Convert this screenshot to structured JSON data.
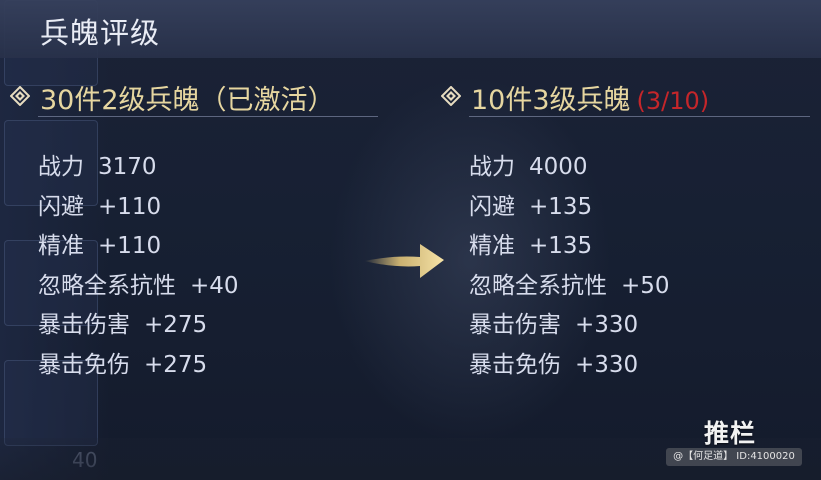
{
  "title": "兵魄评级",
  "left_panel": {
    "header": "30件2级兵魄（已激活）",
    "stats": [
      {
        "label": "战力",
        "value": "3170"
      },
      {
        "label": "闪避",
        "value": "+110"
      },
      {
        "label": "精准",
        "value": "+110"
      },
      {
        "label": "忽略全系抗性",
        "value": "+40"
      },
      {
        "label": "暴击伤害",
        "value": "+275"
      },
      {
        "label": "暴击免伤",
        "value": "+275"
      }
    ]
  },
  "right_panel": {
    "header": "10件3级兵魄",
    "progress": "(3/10)",
    "stats": [
      {
        "label": "战力",
        "value": "4000"
      },
      {
        "label": "闪避",
        "value": "+135"
      },
      {
        "label": "精准",
        "value": "+135"
      },
      {
        "label": "忽略全系抗性",
        "value": "+50"
      },
      {
        "label": "暴击伤害",
        "value": "+330"
      },
      {
        "label": "暴击免伤",
        "value": "+330"
      }
    ]
  },
  "side_number": "40",
  "watermark": "推栏",
  "credit": "@【何足道】 ID:4100020",
  "colors": {
    "header_gold": "#e6d6a0",
    "progress_red": "#c4262a",
    "stat_text": "#d7dcec",
    "arrow_gold": "#e8c97a"
  },
  "icons": {
    "header_marker": "diamond-icon",
    "upgrade_arrow": "arrow-right-icon"
  }
}
